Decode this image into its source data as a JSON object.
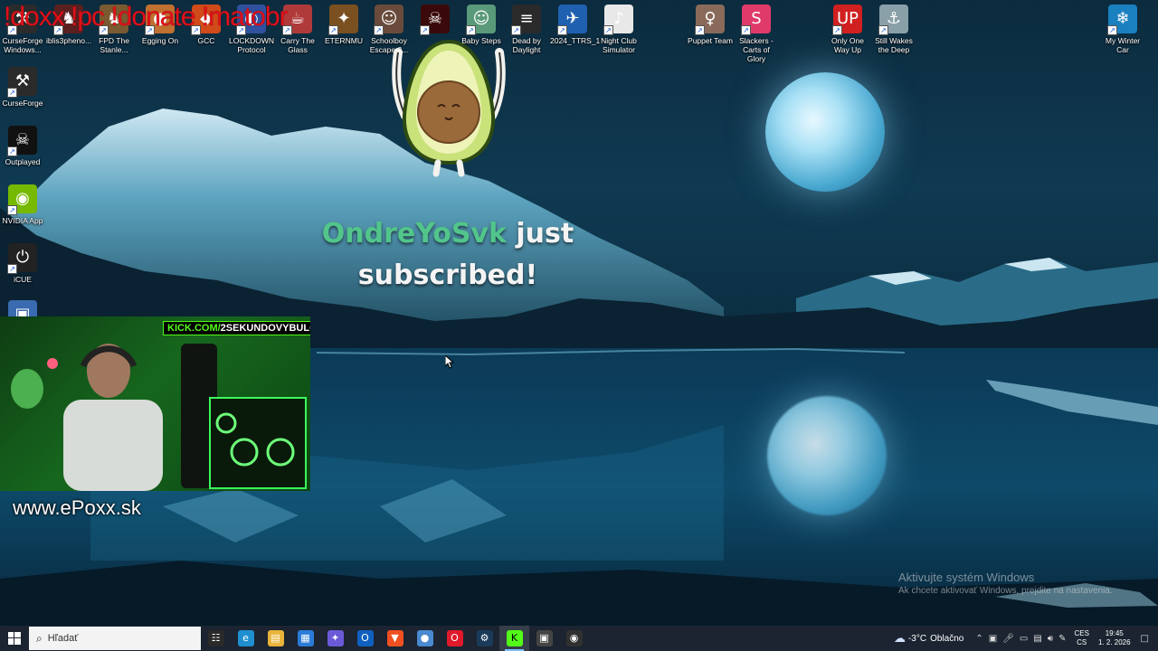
{
  "overlay": {
    "chat_commands": "!doxx !pc !donate !matobr",
    "sub_alert": {
      "username": "OndreYoSvk",
      "text_after_name": "just",
      "line2": "subscribed!"
    },
    "kick_tag": {
      "prefix": "KICK.COM/",
      "channel": "2SEKUNDOVYBULO"
    },
    "site_url": "www.ePoxx.sk"
  },
  "desktop_icons": [
    {
      "label": "CurseForge\nWindows...",
      "icon": "curseforge-windows-icon",
      "color": "#2b2b2b"
    },
    {
      "label": "iblis3pheno...",
      "icon": "game-icon",
      "color": "#5a2020"
    },
    {
      "label": "FPD The\nStanle...",
      "icon": "game-icon",
      "color": "#7a5a30"
    },
    {
      "label": "Egging On",
      "icon": "egg-icon",
      "color": "#c07030"
    },
    {
      "label": "GCC",
      "icon": "gcc-icon",
      "color": "#d04a1a"
    },
    {
      "label": "LOCKDOWN\nProtocol",
      "icon": "lockdown-icon",
      "color": "#3050a0"
    },
    {
      "label": "Carry The\nGlass",
      "icon": "glass-icon",
      "color": "#b03a3a"
    },
    {
      "label": "ETERNMU",
      "icon": "eternmu-icon",
      "color": "#7a5020"
    },
    {
      "label": "Schoolboy\nEscape 2...",
      "icon": "schoolboy-icon",
      "color": "#6a4a3a"
    },
    {
      "label": "",
      "icon": "dark-game-icon",
      "color": "#3a0a0a"
    },
    {
      "label": "Baby Steps",
      "icon": "baby-steps-icon",
      "color": "#5a9a7a"
    },
    {
      "label": "Dead by\nDaylight",
      "icon": "dead-by-daylight-icon",
      "color": "#2a2a2a"
    },
    {
      "label": "2024_TTRS_1",
      "icon": "ttrs-icon",
      "color": "#2060b0"
    },
    {
      "label": "Night Club\nSimulator",
      "icon": "night-club-icon",
      "color": "#e8e8e8"
    },
    {
      "label": "Puppet Team",
      "icon": "puppet-icon",
      "color": "#8a6a5a"
    },
    {
      "label": "Slackers -\nCarts of Glory",
      "icon": "slackers-icon",
      "color": "#e03a6a"
    },
    {
      "label": "Only One\nWay Up",
      "icon": "only-one-way-up-icon",
      "color": "#d02020"
    },
    {
      "label": "Still Wakes\nthe Deep",
      "icon": "still-wakes-icon",
      "color": "#8aa0a8"
    },
    {
      "label": "My Winter\nCar",
      "icon": "my-winter-car-icon",
      "color": "#1a80c0"
    },
    {
      "label": "CurseForge",
      "icon": "curseforge-icon",
      "color": "#2b2b2b"
    },
    {
      "label": "Outplayed",
      "icon": "outplayed-icon",
      "color": "#111111"
    },
    {
      "label": "NVIDIA App",
      "icon": "nvidia-icon",
      "color": "#76b900"
    },
    {
      "label": "iCUE",
      "icon": "icue-icon",
      "color": "#222222"
    },
    {
      "label": "",
      "icon": "this-pc-icon",
      "color": "#3a6ab0"
    }
  ],
  "watermark": {
    "title": "Aktivujte systém Windows",
    "subtitle": "Ak chcete aktivovať Windows, prejdite na nastavenia."
  },
  "taskbar": {
    "search_placeholder": "Hľadať",
    "apps": [
      {
        "icon": "task-view-icon",
        "color": "#2a2a2a"
      },
      {
        "icon": "edge-icon",
        "color": "#1f8fd0"
      },
      {
        "icon": "file-explorer-icon",
        "color": "#e8b43a"
      },
      {
        "icon": "store-icon",
        "color": "#2b7bd8"
      },
      {
        "icon": "copilot-icon",
        "color": "#6a5ad8"
      },
      {
        "icon": "outlook-icon",
        "color": "#1060c0"
      },
      {
        "icon": "brave-icon",
        "color": "#f05020"
      },
      {
        "icon": "browser-icon",
        "color": "#4a8ad0"
      },
      {
        "icon": "opera-icon",
        "color": "#e01a2a"
      },
      {
        "icon": "steam-icon",
        "color": "#1a3a5a"
      },
      {
        "icon": "kick-icon",
        "color": "#53fc18"
      },
      {
        "icon": "streamer-app-icon",
        "color": "#444444"
      },
      {
        "icon": "obs-icon",
        "color": "#303030"
      }
    ],
    "active_app_index": 10,
    "weather": {
      "temp": "-3°C",
      "condition": "Oblačno",
      "icon": "cloudy-icon"
    },
    "language": {
      "line1": "CES",
      "line2": "CS"
    },
    "clock": {
      "time": "19:45",
      "date": "1. 2. 2026"
    }
  }
}
